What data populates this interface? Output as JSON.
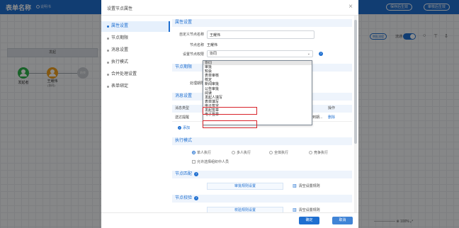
{
  "app": {
    "title": "表单名称",
    "help_link": "说明书",
    "save_publish": "保存后生效",
    "audit_publish": "审核后生效"
  },
  "canvas": {
    "start_banner": "发起",
    "nodes": [
      {
        "label": "发起者",
        "sub": ""
      },
      {
        "label": "王耀伟",
        "sub": "(协同)"
      },
      {
        "label": "结束",
        "sub": ""
      }
    ],
    "tool_view": "审批流程",
    "toggle_label": "流通",
    "zoom": "100%"
  },
  "modal": {
    "title": "设置节点属性",
    "close": "×",
    "nav": [
      "属性设置",
      "节点期限",
      "消息设置",
      "执行模式",
      "合并处理设置",
      "表单绑定"
    ],
    "sections": {
      "property": "属性设置",
      "deadline": "节点期限",
      "message": "消息设置",
      "exec_mode": "执行模式",
      "matching": "节点匹配",
      "validation": "节点校验"
    },
    "fields": {
      "custom_name_label": "自定义节点名称",
      "custom_name_value": "王耀伟",
      "node_name_label": "节点名称",
      "node_name_value": "王耀伟",
      "permission_label": "设置节点权限",
      "permission_value": "协同",
      "deadline_label": "处理期限"
    },
    "message_table": {
      "col_type": "消息类型",
      "col_action": "操作",
      "row_type": "送达提醒",
      "row_tail": "到期...",
      "row_action": "删除",
      "add": "添加"
    },
    "exec_modes": [
      "单人执行",
      "多人执行",
      "全体执行",
      "竞争执行"
    ],
    "exec_selected": 0,
    "exec_checkbox": "允许选择组织中人员",
    "matching_button": "审批规则设置",
    "matching_clear": "清空设置规则",
    "validation_button": "校验规则设置",
    "validation_clear": "清空设置规则",
    "ok": "确定",
    "cancel": "取消"
  },
  "permission_dropdown": {
    "options": [
      "协同",
      "审批",
      "知会",
      "表单审核",
      "核定",
      "新闻审批",
      "公告审批",
      "阅读",
      "发起人填写",
      "表单填写",
      "电子签字",
      "发起签章",
      "电子签章"
    ],
    "selected": 0,
    "highlighted": [
      10,
      12
    ]
  },
  "colors": {
    "accent": "#1f6fd0",
    "highlight_box": "#d8232a",
    "start_node": "#2cb34a",
    "approver_node": "#f0a020"
  }
}
